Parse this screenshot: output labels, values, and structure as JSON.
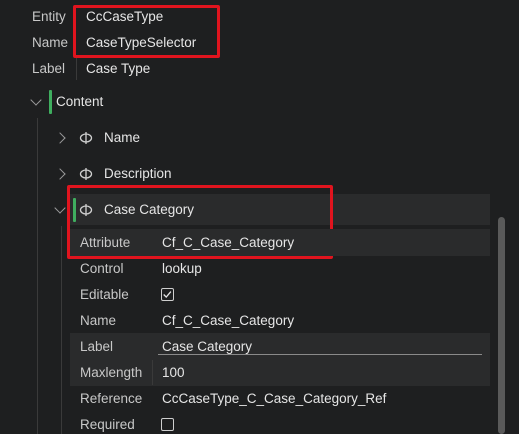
{
  "entity": {
    "label": "Entity",
    "value": "CcCaseType"
  },
  "name": {
    "label": "Name",
    "value": "CaseTypeSelector"
  },
  "label_row": {
    "label": "Label",
    "value": "Case Type"
  },
  "content": {
    "label": "Content"
  },
  "children": [
    {
      "label": "Name"
    },
    {
      "label": "Description"
    },
    {
      "label": "Case Category"
    }
  ],
  "props": {
    "attribute": {
      "label": "Attribute",
      "value": "Cf_C_Case_Category"
    },
    "control": {
      "label": "Control",
      "value": "lookup"
    },
    "editable": {
      "label": "Editable",
      "checked": true
    },
    "name": {
      "label": "Name",
      "value": "Cf_C_Case_Category"
    },
    "label": {
      "label": "Label",
      "value": "Case Category"
    },
    "maxlength": {
      "label": "Maxlength",
      "value": "100"
    },
    "reference": {
      "label": "Reference",
      "value": "CcCaseType_C_Case_Category_Ref"
    },
    "required": {
      "label": "Required",
      "checked": false
    }
  },
  "colors": {
    "highlight": "#e0141e",
    "accent_green": "#3fae5f"
  }
}
